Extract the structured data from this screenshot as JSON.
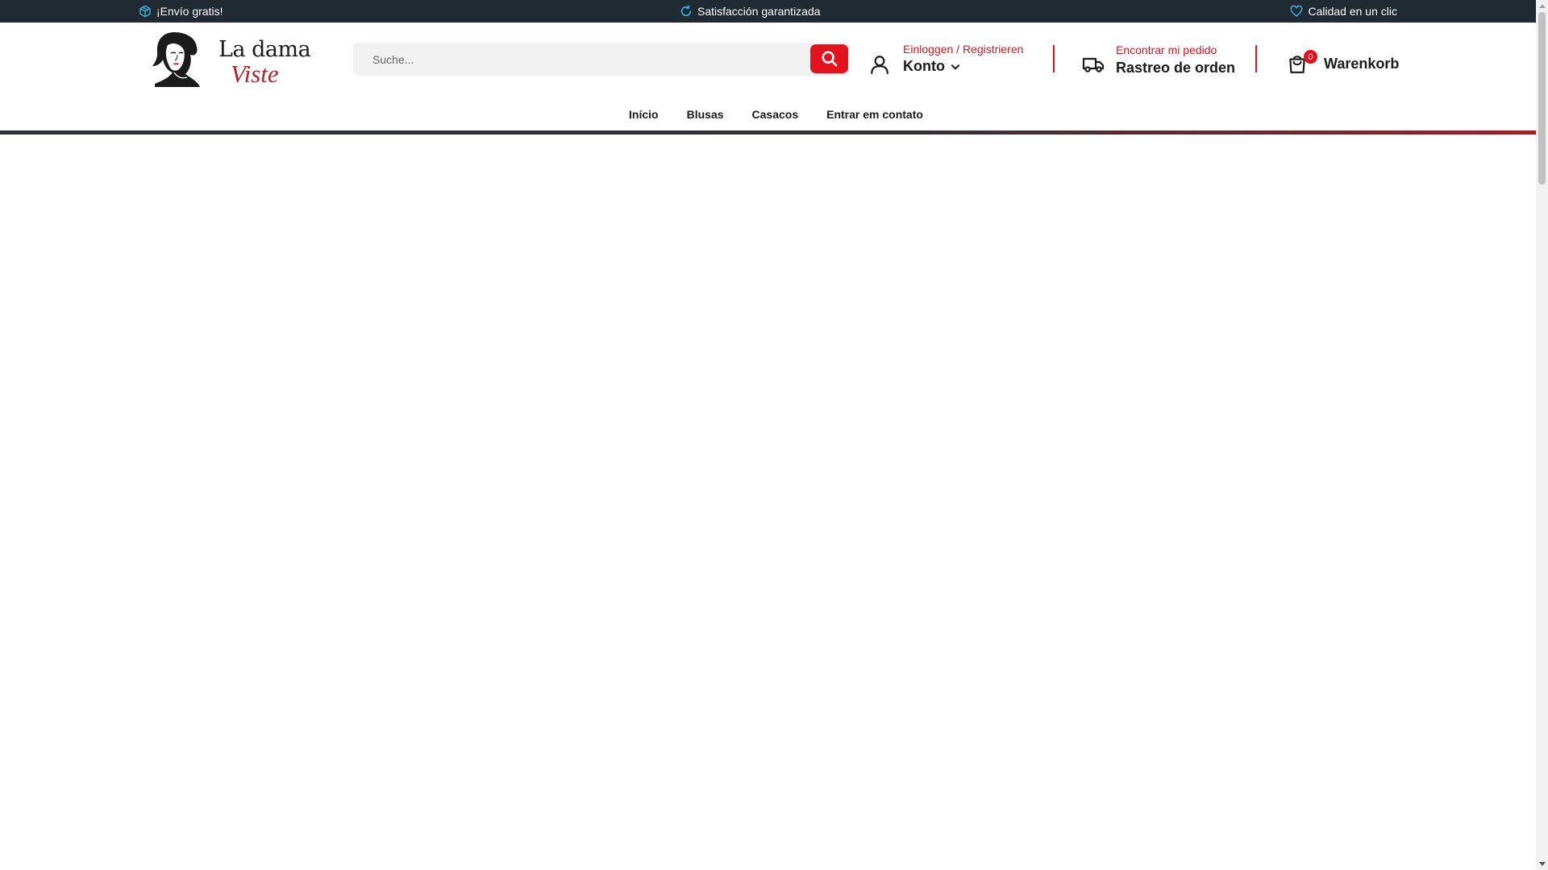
{
  "topbar": {
    "items": [
      {
        "label": "¡Envío gratis!",
        "icon": "box-icon"
      },
      {
        "label": "Satisfacción garantizada",
        "icon": "refresh-icon"
      },
      {
        "label": "Calidad en un clic",
        "icon": "heart-icon"
      }
    ],
    "icon_color": "#3fb6e8",
    "background": "#1f2a33"
  },
  "logo": {
    "line1": "La dama",
    "line2": "Viste",
    "accent_color": "#b3222d"
  },
  "search": {
    "placeholder": "Suche...",
    "value": "",
    "button_color": "#e3121d"
  },
  "account": {
    "sub_label": "Einloggen / Registrieren",
    "main_label": "Konto"
  },
  "tracking": {
    "sub_label": "Encontrar mi pedido",
    "main_label": "Rastreo de orden"
  },
  "cart": {
    "count": "0",
    "label": "Warenkorb"
  },
  "nav": {
    "items": [
      {
        "label": "Início"
      },
      {
        "label": "Blusas"
      },
      {
        "label": "Casacos"
      },
      {
        "label": "Entrar em contato"
      }
    ]
  },
  "accent_color": "#e3121d"
}
